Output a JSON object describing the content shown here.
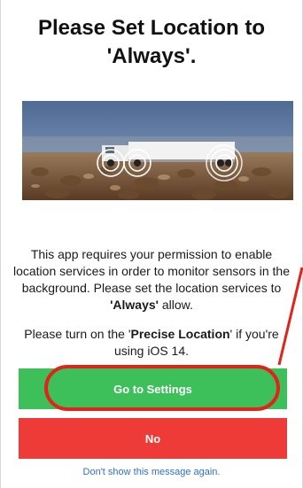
{
  "dialog": {
    "title": "Please Set Location to 'Always'.",
    "description_1_prefix": "This app requires your permission to enable location services in order to monitor sensors in the background. Please set the location services to ",
    "description_1_bold": "'Always'",
    "description_1_suffix": " allow.",
    "description_2_prefix": "Please turn on the '",
    "description_2_bold": "Precise Location",
    "description_2_suffix": "' if you're using iOS 14.",
    "go_to_settings_label": "Go to Settings",
    "no_label": "No",
    "dont_show_label": "Don't show this message again."
  },
  "colors": {
    "settings_button": "#3dc05a",
    "no_button": "#ef3b38",
    "annotation_red": "#e0231b",
    "link_blue": "#2f6fd6"
  }
}
